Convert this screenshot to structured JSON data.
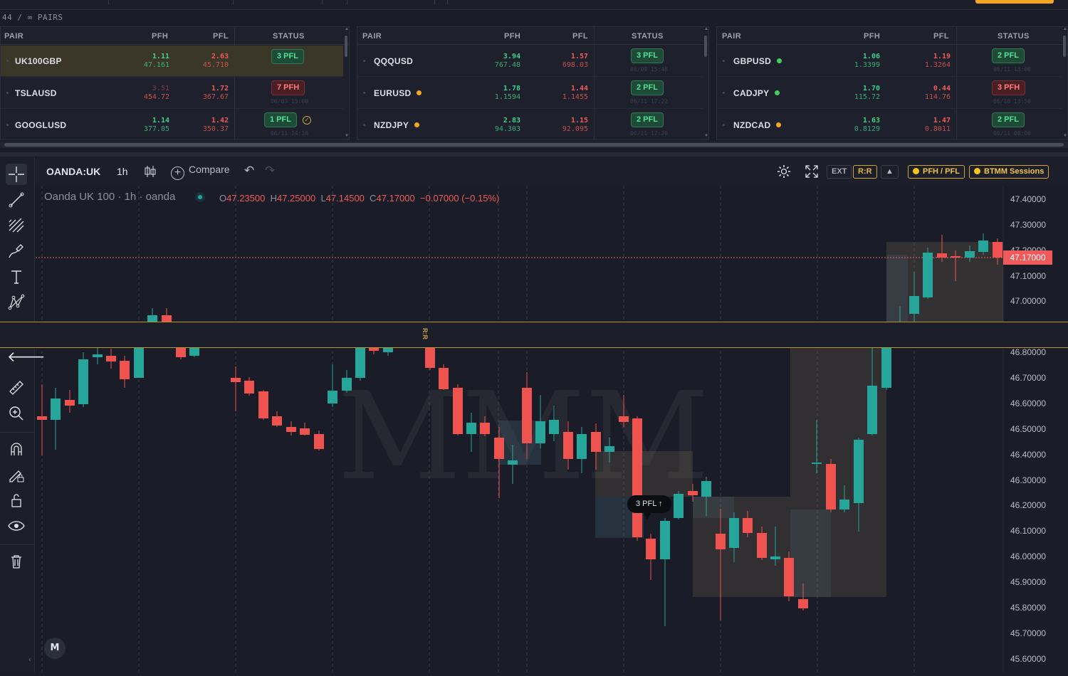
{
  "pairs_count": "44 / ∞ PAIRS",
  "table_headers": {
    "pair": "PAIR",
    "pfh": "PFH",
    "pfl": "PFL",
    "status": "STATUS"
  },
  "panels": [
    {
      "rows": [
        {
          "pair": "UK100GBP",
          "pfh_top": "1.11",
          "pfh_bot": "47.161",
          "pfl_top": "2.63",
          "pfl_bot": "45.710",
          "status": "3 PFL",
          "status_type": "pfl",
          "selected": true
        },
        {
          "pair": "TSLAUSD",
          "pfh_top": "3.51",
          "pfh_bot": "454.72",
          "pfl_top": "1.72",
          "pfl_bot": "367.67",
          "status": "7 PFH",
          "status_type": "pfh",
          "ts": "06/03 15:00"
        },
        {
          "pair": "GOOGLUSD",
          "pfh_top": "1.14",
          "pfh_bot": "377.05",
          "pfl_top": "1.42",
          "pfl_bot": "350.37",
          "status": "1 PFL",
          "status_type": "pfl",
          "ts": "06/11 14:10"
        }
      ]
    },
    {
      "rows": [
        {
          "pair": "QQQUSD",
          "pfh_top": "3.94",
          "pfh_bot": "767.48",
          "pfl_top": "1.57",
          "pfl_bot": "698.03",
          "status": "3 PFL",
          "status_type": "pfl",
          "ts": "06/09 15:40"
        },
        {
          "pair": "EURUSD",
          "pfh_top": "1.78",
          "pfh_bot": "1.1594",
          "pfl_top": "1.44",
          "pfl_bot": "1.1455",
          "status": "2 PFL",
          "status_type": "pfl",
          "ts": "06/11 17:22",
          "dot": "#f5a623"
        },
        {
          "pair": "NZDJPY",
          "pfh_top": "2.83",
          "pfh_bot": "94.303",
          "pfl_top": "1.15",
          "pfl_bot": "92.095",
          "status": "2 PFL",
          "status_type": "pfl",
          "ts": "06/11 17:29",
          "dot": "#f5a623"
        }
      ]
    },
    {
      "rows": [
        {
          "pair": "GBPUSD",
          "pfh_top": "1.06",
          "pfh_bot": "1.3399",
          "pfl_top": "1.19",
          "pfl_bot": "1.3264",
          "status": "2 PFL",
          "status_type": "pfl",
          "ts": "06/11 13:00",
          "dot": "#3ecf5e"
        },
        {
          "pair": "CADJPY",
          "pfh_top": "1.70",
          "pfh_bot": "115.72",
          "pfl_top": "0.44",
          "pfl_bot": "114.76",
          "status": "3 PFH",
          "status_type": "pfh",
          "ts": "06/10 13:50",
          "dot": "#3ecf5e"
        },
        {
          "pair": "NZDCAD",
          "pfh_top": "1.63",
          "pfh_bot": "0.8129",
          "pfl_top": "1.47",
          "pfl_bot": "0.8011",
          "status": "2 PFL",
          "status_type": "pfl",
          "ts": "06/11 08:00",
          "dot": "#f5a623"
        }
      ]
    }
  ],
  "header": {
    "symbol": "OANDA:UK",
    "timeframe": "1h",
    "compare": "Compare",
    "ext": "EXT",
    "rr": "R:R",
    "up_arrow": "▲",
    "pfh_pfl_btn": "PFH / PFL",
    "btmm_btn": "BTMM Sessions"
  },
  "legend": {
    "title": "Oanda UK 100 · 1h · oanda",
    "o_label": "O",
    "o_val": "47.23500",
    "h_label": "H",
    "h_val": "47.25000",
    "l_label": "L",
    "l_val": "47.14500",
    "c_label": "C",
    "c_val": "47.17000",
    "change": "−0.07000 (−0.15%)"
  },
  "rr_label": "R:R",
  "last_price": "47.17000",
  "callout": "3 PFL ↑",
  "watermark": "MMM",
  "price_axis": [
    "47.40000",
    "47.30000",
    "47.20000",
    "47.10000",
    "47.00000",
    "46.80000",
    "46.70000",
    "46.60000",
    "46.50000",
    "46.40000",
    "46.30000",
    "46.20000",
    "46.10000",
    "46.00000",
    "45.90000",
    "45.80000",
    "45.70000",
    "45.60000"
  ],
  "colors": {
    "up": "#26a69a",
    "down": "#ef5350",
    "accent": "#d1a23a",
    "bg": "#1a1d27"
  },
  "tools": [
    "crosshair-icon",
    "trendline-icon",
    "fib-icon",
    "brush-icon",
    "text-icon",
    "pattern-icon",
    "back-arrow-icon",
    "ruler-icon",
    "zoom-in-icon",
    "magnet-icon",
    "lock-pencil-icon",
    "unlock-icon",
    "eye-icon",
    "trash-icon"
  ]
}
